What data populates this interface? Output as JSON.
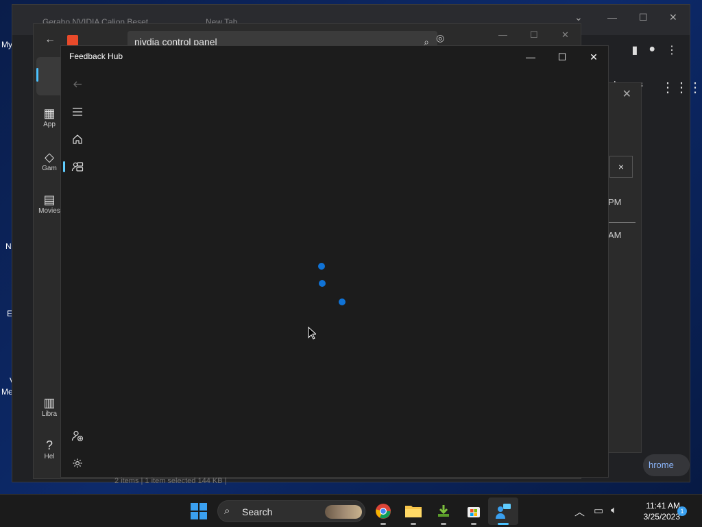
{
  "desktop": {
    "icon_labels": [
      "My",
      "N",
      "E",
      "V",
      "Me"
    ]
  },
  "chrome": {
    "tabs": [
      "Geraho NVIDIA Calion Beset",
      "New Tab"
    ],
    "images_label": "Images",
    "chrome_label": "hrome",
    "apps_icon": "apps-grid-icon"
  },
  "dialog": {
    "field_value": "×",
    "row1": "PM",
    "row2": "AM"
  },
  "store": {
    "search_value": "nivdia control panel",
    "nav": [
      {
        "label": "App",
        "icon": "apps-icon"
      },
      {
        "label": "Gam",
        "icon": "gaming-icon"
      },
      {
        "label": "Movies",
        "icon": "movies-icon"
      },
      {
        "label": "Libra",
        "icon": "library-icon"
      },
      {
        "label": "Hel",
        "icon": "help-icon"
      }
    ],
    "status": "2 items  |  1 item selected  144 KB  |"
  },
  "feedback_hub": {
    "title": "Feedback Hub",
    "minimize": "—",
    "maximize": "☐",
    "close": "✕",
    "loading": true
  },
  "taskbar": {
    "search_label": "Search",
    "time": "11:41 AM",
    "date": "3/25/2023",
    "notification_count": "1",
    "apps": [
      "chrome-icon",
      "file-explorer-icon",
      "gear-download-icon",
      "microsoft-store-icon",
      "feedback-hub-icon"
    ]
  },
  "colors": {
    "accent": "#1073d6",
    "active_indicator": "#60cdff",
    "window_bg": "#1c1c1c"
  }
}
